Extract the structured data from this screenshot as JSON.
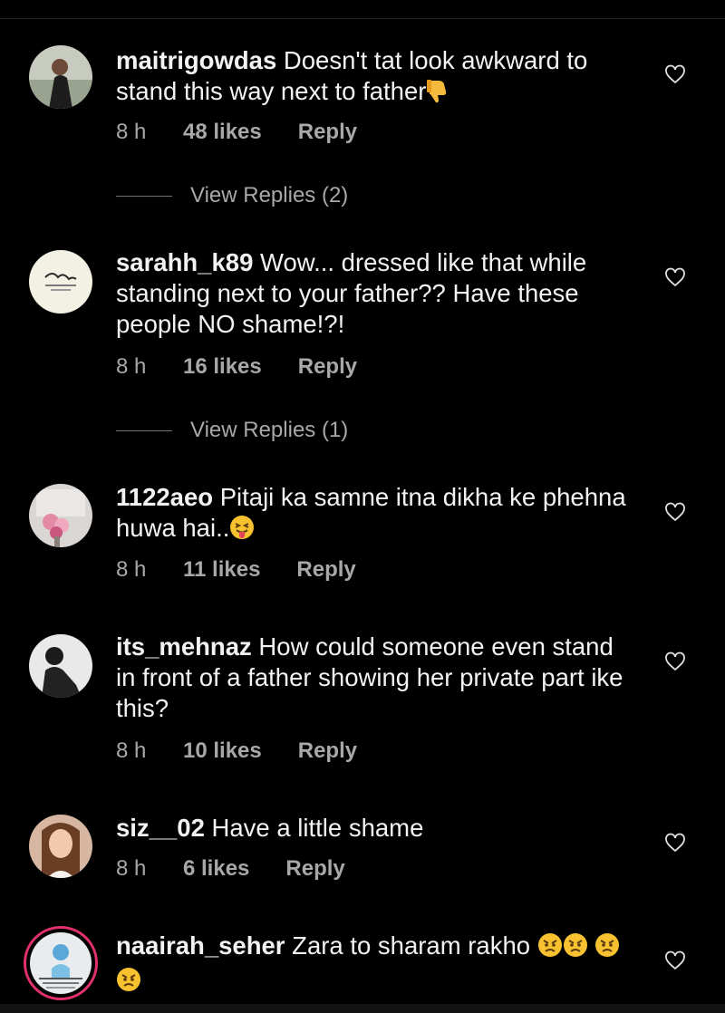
{
  "comments": [
    {
      "username": "maitrigowdas",
      "text": "Doesn't tat look awkward to stand this way next to father",
      "time": "8 h",
      "likes": "48 likes",
      "reply": "Reply",
      "view_replies": "View Replies (2)",
      "emoji": "thumbs-down-icon"
    },
    {
      "username": "sarahh_k89",
      "text": "Wow... dressed like that while standing next to your father?? Have these people NO shame!?!",
      "time": "8 h",
      "likes": "16 likes",
      "reply": "Reply",
      "view_replies": "View Replies (1)"
    },
    {
      "username": "1122aeo",
      "text": "Pitaji ka samne itna dikha ke phehna huwa hai..",
      "time": "8 h",
      "likes": "11 likes",
      "reply": "Reply",
      "emoji": "tongue-wink-emoji"
    },
    {
      "username": "its_mehnaz",
      "text": "How could someone even stand in front of a father showing her private part ike this?",
      "time": "8 h",
      "likes": "10 likes",
      "reply": "Reply"
    },
    {
      "username": "siz__02",
      "text": "Have a little shame",
      "time": "8 h",
      "likes": "6 likes",
      "reply": "Reply"
    },
    {
      "username": "naairah_seher",
      "text": "Zara to sharam rakho",
      "emoji": "angry-face-emoji"
    }
  ],
  "colors": {
    "background": "#000000",
    "text": "#f2f2f2",
    "meta": "#a8a8a8",
    "story_ring": "#e1306c"
  }
}
